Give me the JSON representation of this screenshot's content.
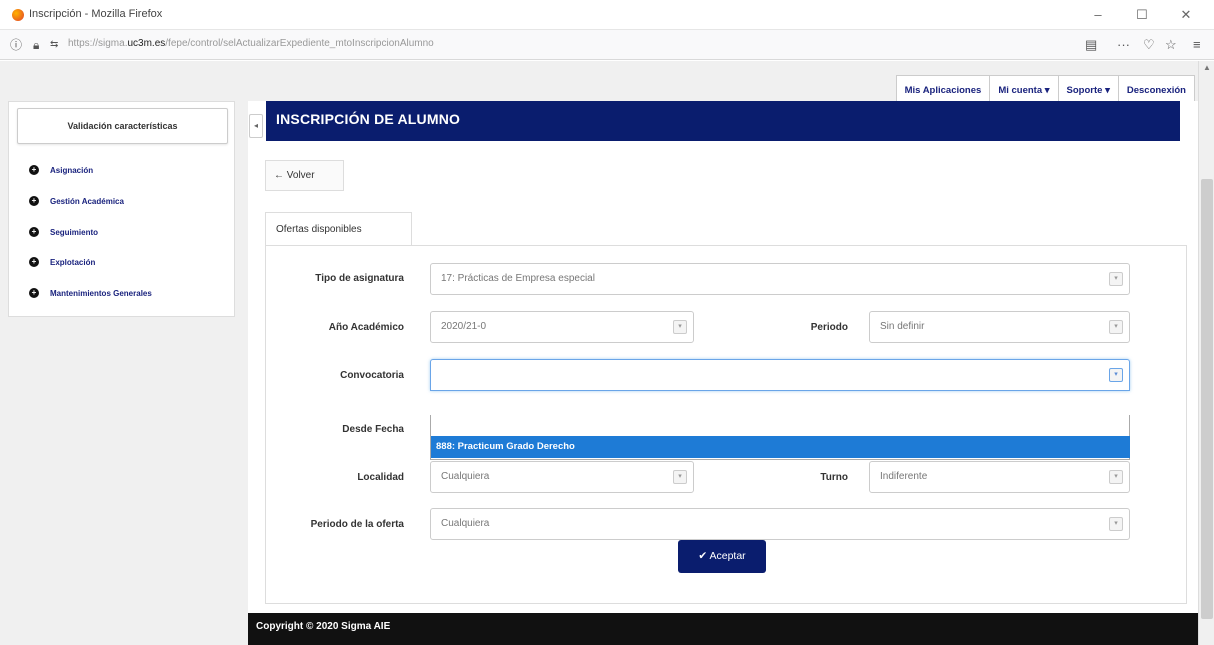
{
  "window": {
    "title": "Inscripción - Mozilla Firefox",
    "minimize": "–",
    "maximize": "☐",
    "close": "✕"
  },
  "browser": {
    "url_prefix": "https://sigma.",
    "url_host": "uc3m.es",
    "url_path": "/fepe/control/selActualizarExpediente_mtoInscripcionAlumno",
    "reader_icon": "▤",
    "more_icon": "···",
    "pocket_icon": "♡",
    "star_icon": "☆",
    "menu_icon": "≡"
  },
  "topmenu": {
    "aplicaciones": "Mis Aplicaciones",
    "cuenta": "Mi cuenta ▾",
    "soporte": "Soporte ▾",
    "desconexion": "Desconexión"
  },
  "sidebar": {
    "header": "Validación características",
    "items": [
      {
        "label": "Asignación"
      },
      {
        "label": "Gestión Académica"
      },
      {
        "label": "Seguimiento"
      },
      {
        "label": "Explotación"
      },
      {
        "label": "Mantenimientos Generales"
      }
    ]
  },
  "main": {
    "title": "INSCRIPCIÓN DE ALUMNO",
    "volver": "Volver",
    "tab": "Ofertas disponibles",
    "fields": {
      "tipo_label": "Tipo de asignatura",
      "tipo_value": "17: Prácticas de Empresa especial",
      "anio_label": "Año Académico",
      "anio_value": "2020/21-0",
      "periodo_label": "Periodo",
      "periodo_value": "Sin definir",
      "convocatoria_label": "Convocatoria",
      "convocatoria_value": "",
      "convocatoria_option": "888: Practicum Grado Derecho",
      "desde_label": "Desde Fecha",
      "localidad_label": "Localidad",
      "localidad_value": "Cualquiera",
      "turno_label": "Turno",
      "turno_value": "Indiferente",
      "periodo_oferta_label": "Periodo de la oferta",
      "periodo_oferta_value": "Cualquiera"
    },
    "aceptar": "Aceptar"
  },
  "footer": {
    "text": "Copyright © 2020 Sigma AIE"
  },
  "colors": {
    "brand_navy": "#0a1d6e",
    "option_highlight": "#1e7bd6",
    "link_blue": "#1a237e"
  }
}
